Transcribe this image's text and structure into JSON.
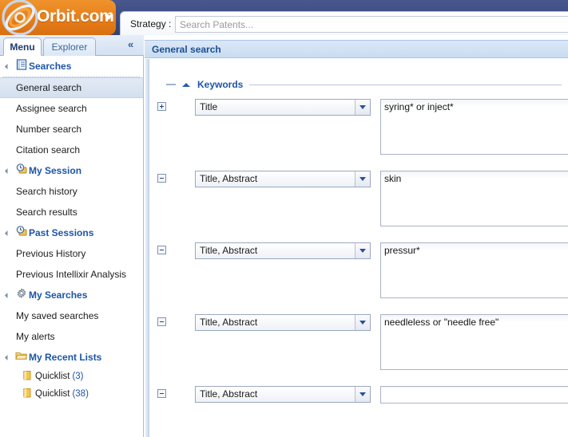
{
  "brand": {
    "name": "Orbit.com",
    "caret_icon": "caret-down-icon",
    "logo_icon": "orbit-swirl-logo"
  },
  "strategy": {
    "label": "Strategy :",
    "placeholder": "Search Patents...",
    "value": ""
  },
  "sidebar": {
    "tabs": [
      {
        "label": "Menu",
        "active": true
      },
      {
        "label": "Explorer",
        "active": false
      }
    ],
    "collapse_icon": "«",
    "groups": [
      {
        "label": "Searches",
        "icon": "list-document-icon",
        "items": [
          {
            "label": "General search",
            "selected": true
          },
          {
            "label": "Assignee search",
            "selected": false
          },
          {
            "label": "Number search",
            "selected": false
          },
          {
            "label": "Citation search",
            "selected": false
          }
        ]
      },
      {
        "label": "My Session",
        "icon": "clock-history-icon",
        "items": [
          {
            "label": "Search history",
            "selected": false
          },
          {
            "label": "Search results",
            "selected": false
          }
        ]
      },
      {
        "label": "Past Sessions",
        "icon": "clock-history-icon",
        "items": [
          {
            "label": "Previous History",
            "selected": false
          },
          {
            "label": "Previous Intellixir Analysis",
            "selected": false
          }
        ]
      },
      {
        "label": "My Searches",
        "icon": "gear-icon",
        "items": [
          {
            "label": "My saved searches",
            "selected": false
          },
          {
            "label": "My alerts",
            "selected": false
          }
        ]
      },
      {
        "label": "My Recent Lists",
        "icon": "folder-open-icon",
        "sublists": [
          {
            "label": "Quicklist",
            "count": "(3)",
            "icon": "notepad-icon"
          },
          {
            "label": "Quicklist",
            "count": "(38)",
            "icon": "notepad-icon"
          }
        ]
      }
    ]
  },
  "panel": {
    "title": "General search"
  },
  "section": {
    "label": "Keywords",
    "collapse_icon": "triangle-up-icon"
  },
  "rows": [
    {
      "expander": "plus",
      "field": "Title",
      "query": "syring* or inject*",
      "tall": true
    },
    {
      "expander": "minus",
      "field": "Title, Abstract",
      "query": "skin",
      "tall": true
    },
    {
      "expander": "minus",
      "field": "Title, Abstract",
      "query": "pressur*",
      "tall": true
    },
    {
      "expander": "minus",
      "field": "Title, Abstract",
      "query": "needleless or \"needle free\"",
      "tall": true
    },
    {
      "expander": "minus",
      "field": "Title, Abstract",
      "query": "",
      "tall": false
    }
  ],
  "field_options": [
    "Title",
    "Title, Abstract"
  ],
  "colors": {
    "brand_orange": "#e8801a",
    "header_blue": "#3c4a80",
    "link_blue": "#1b55a8",
    "panel_blue": "#c9dcf1"
  }
}
